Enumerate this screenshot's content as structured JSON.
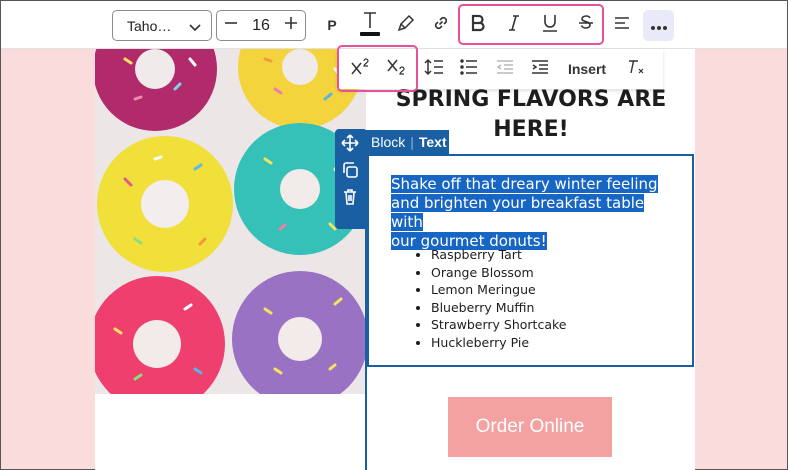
{
  "toolbar": {
    "font_family": "Taho…",
    "font_size": "16",
    "paragraph_label": "P",
    "insert_label": "Insert"
  },
  "block_tag": {
    "block": "Block",
    "text": "Text"
  },
  "email": {
    "heading_line1": "SPRING FLAVORS ARE",
    "heading_line2": "HERE!",
    "paragraph_line1": "Shake off that dreary winter feeling",
    "paragraph_line2": "and brighten your breakfast table with",
    "paragraph_line3": "our gourmet donuts!",
    "flavors": [
      "Raspberry Tart",
      "Orange Blossom",
      "Lemon Meringue",
      "Blueberry Muffin",
      "Strawberry Shortcake",
      "Huckleberry Pie"
    ],
    "button_label": "Order Online"
  },
  "colors": {
    "accent_blue": "#1b5fa3",
    "highlight_pink": "#e8519a",
    "button_pink": "#f4a1a1",
    "canvas_pink": "#fbdcdc",
    "selection": "#1766c4"
  },
  "icons": [
    "chevron-down-icon",
    "minus-icon",
    "plus-icon",
    "text-color-icon",
    "highlighter-icon",
    "link-icon",
    "bold-icon",
    "italic-icon",
    "underline-icon",
    "strikethrough-icon",
    "align-icon",
    "more-icon",
    "superscript-icon",
    "subscript-icon",
    "line-height-icon",
    "list-icon",
    "outdent-icon",
    "indent-icon",
    "clear-format-icon",
    "move-icon",
    "duplicate-icon",
    "delete-icon"
  ]
}
